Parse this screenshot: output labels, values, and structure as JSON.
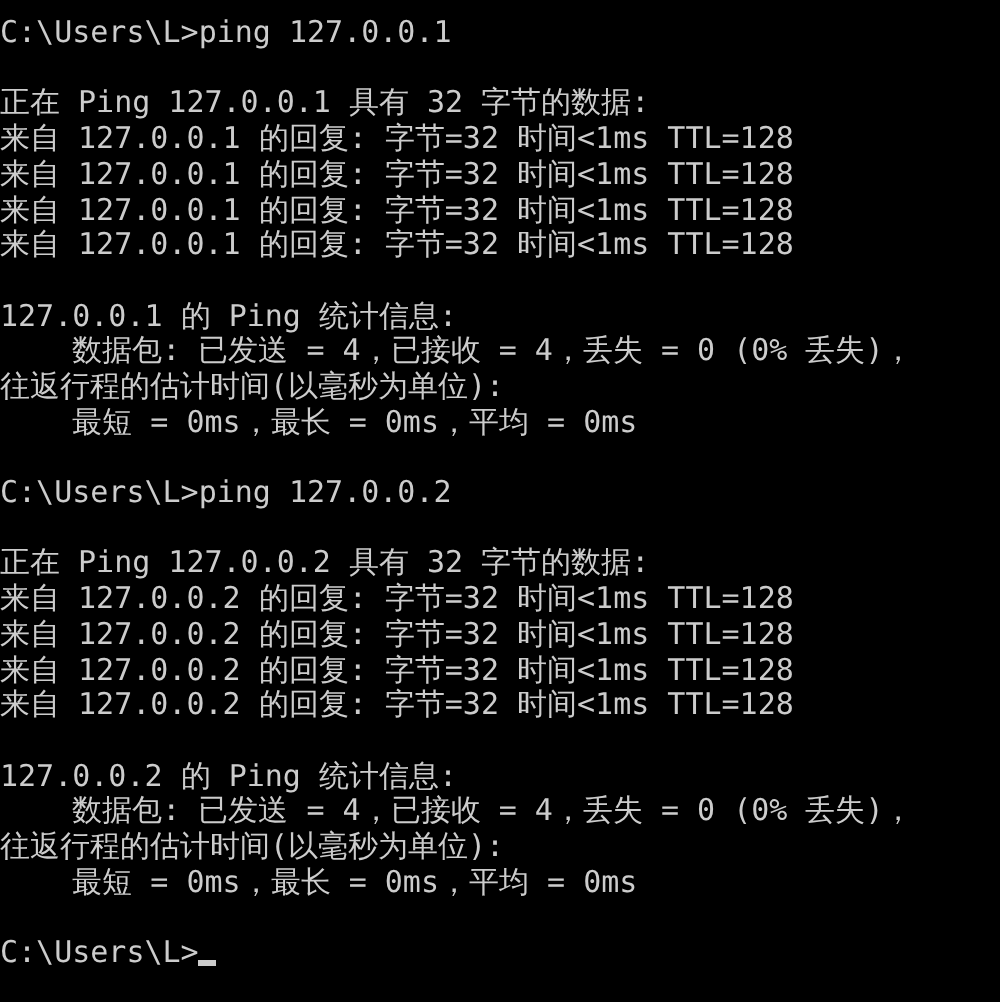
{
  "console": {
    "blocks": [
      [
        "C:\\Users\\L>ping 127.0.0.1"
      ],
      [
        "正在 Ping 127.0.0.1 具有 32 字节的数据:",
        "来自 127.0.0.1 的回复: 字节=32 时间<1ms TTL=128",
        "来自 127.0.0.1 的回复: 字节=32 时间<1ms TTL=128",
        "来自 127.0.0.1 的回复: 字节=32 时间<1ms TTL=128",
        "来自 127.0.0.1 的回复: 字节=32 时间<1ms TTL=128"
      ],
      [
        "127.0.0.1 的 Ping 统计信息:",
        "    数据包: 已发送 = 4，已接收 = 4，丢失 = 0 (0% 丢失)，",
        "往返行程的估计时间(以毫秒为单位):",
        "    最短 = 0ms，最长 = 0ms，平均 = 0ms"
      ],
      [
        "C:\\Users\\L>ping 127.0.0.2"
      ],
      [
        "正在 Ping 127.0.0.2 具有 32 字节的数据:",
        "来自 127.0.0.2 的回复: 字节=32 时间<1ms TTL=128",
        "来自 127.0.0.2 的回复: 字节=32 时间<1ms TTL=128",
        "来自 127.0.0.2 的回复: 字节=32 时间<1ms TTL=128",
        "来自 127.0.0.2 的回复: 字节=32 时间<1ms TTL=128"
      ],
      [
        "127.0.0.2 的 Ping 统计信息:",
        "    数据包: 已发送 = 4，已接收 = 4，丢失 = 0 (0% 丢失)，",
        "往返行程的估计时间(以毫秒为单位):",
        "    最短 = 0ms，最长 = 0ms，平均 = 0ms"
      ]
    ],
    "prompt": {
      "text": "C:\\Users\\L>",
      "cursor": true
    }
  }
}
